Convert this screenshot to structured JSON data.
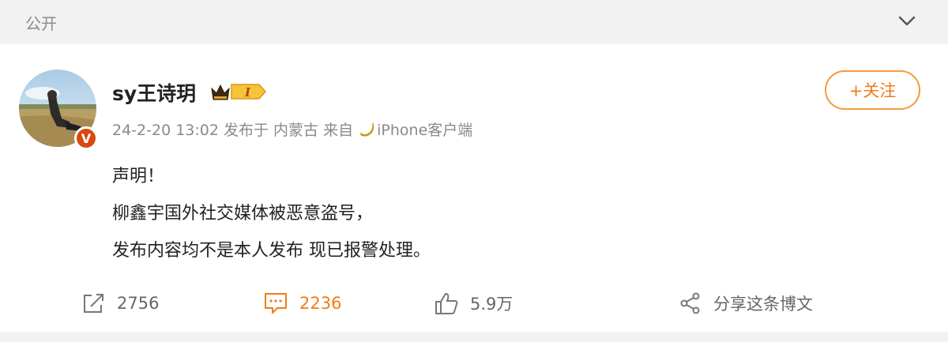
{
  "header": {
    "visibility_label": "公开",
    "expand_icon": "chevron-down-icon"
  },
  "post": {
    "author": {
      "name": "sy王诗玥",
      "verified_badge": "V",
      "member_level": "I"
    },
    "meta": {
      "time": "24-2-20 13:02",
      "location": "发布于 内蒙古",
      "source_prefix": "来自",
      "source": "iPhone客户端"
    },
    "follow_label": "+关注",
    "content_lines": [
      "声明！",
      "柳鑫宇国外社交媒体被恶意盗号，",
      "发布内容均不是本人发布 现已报警处理。"
    ]
  },
  "actions": {
    "repost_count": "2756",
    "comment_count": "2236",
    "like_count": "5.9万",
    "share_label": "分享这条博文"
  },
  "colors": {
    "accent": "#f07c1a",
    "badge": "#d9480f",
    "muted": "#8a8a8a",
    "topbar_bg": "#f2f2f2"
  }
}
